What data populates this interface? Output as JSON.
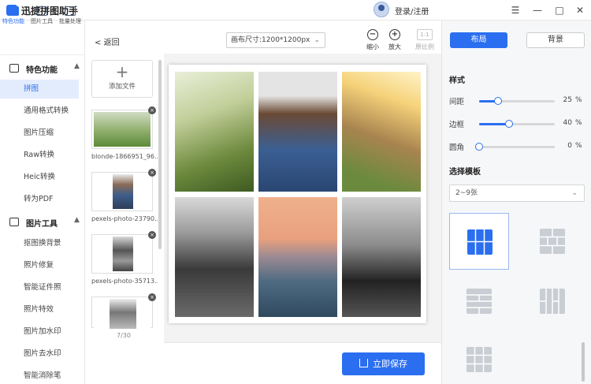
{
  "titlebar": {
    "app_title": "迅捷拼图助手",
    "login": "登录/注册",
    "menu": "☰",
    "minimize": "—",
    "maximize": "□",
    "close": "✕"
  },
  "tool_tabs": [
    {
      "label": "特色功能",
      "icon": "grid-icon"
    },
    {
      "label": "图片工具",
      "icon": "image-tool-icon"
    },
    {
      "label": "批量处理",
      "icon": "batch-icon"
    }
  ],
  "nav": {
    "section1": "特色功能",
    "section1_items": [
      "拼图",
      "通用格式转换",
      "图片压缩",
      "Raw转换",
      "Heic转换",
      "转为PDF"
    ],
    "section2": "图片工具",
    "section2_items": [
      "抠图换背景",
      "照片修复",
      "智能证件照",
      "照片特效",
      "图片加水印",
      "图片去水印",
      "智能消除笔"
    ]
  },
  "files": {
    "add_label": "添加文件",
    "items": [
      "blonde-1866951_96...",
      "pexels-photo-23790...",
      "pexels-photo-35713...",
      ""
    ],
    "count": "7/30"
  },
  "toolbar": {
    "back": "返回",
    "canvas_size": "画布尺寸:1200*1200px",
    "zoom_out": "缩小",
    "zoom_in": "放大",
    "ratio_icon": "1:1",
    "ratio": "原比例"
  },
  "save_label": "立即保存",
  "right": {
    "tab_layout": "布局",
    "tab_background": "背景",
    "style_title": "样式",
    "spacing": {
      "label": "间距",
      "value": "25",
      "unit": "%"
    },
    "border": {
      "label": "边框",
      "value": "40",
      "unit": "%"
    },
    "corner": {
      "label": "圆角",
      "value": "0",
      "unit": "%"
    },
    "template_title": "选择模板",
    "template_select": "2~9张"
  },
  "colors": {
    "accent": "#2b6ff0"
  }
}
